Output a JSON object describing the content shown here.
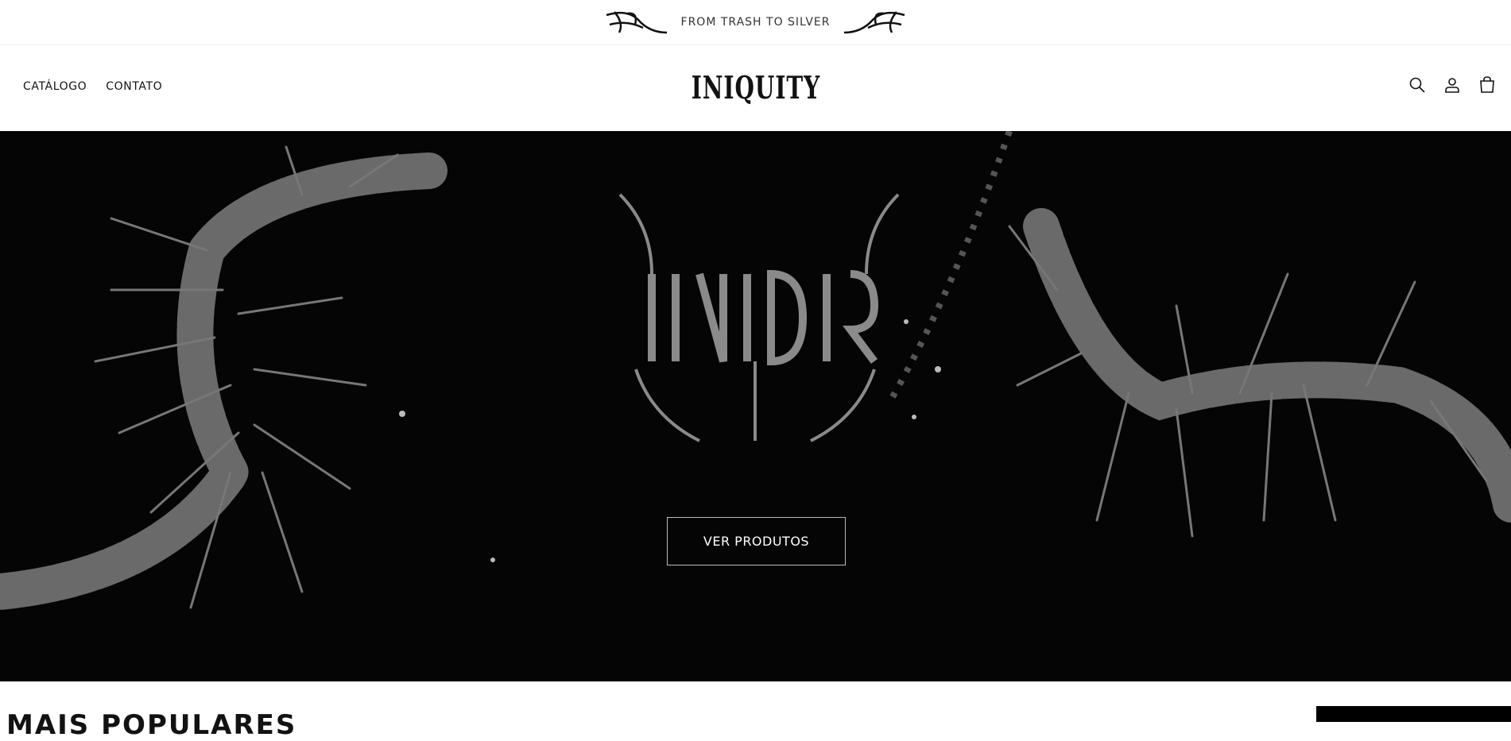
{
  "announcement": {
    "text": "FROM TRASH TO SILVER"
  },
  "header": {
    "nav": [
      {
        "label": "CATÁLOGO"
      },
      {
        "label": "CONTATO"
      }
    ],
    "logo_text": "INIQUITY",
    "icons": [
      "search-icon",
      "account-icon",
      "cart-icon"
    ]
  },
  "hero": {
    "logo_text": "INIQUITY",
    "button_label": "VER PRODUTOS"
  },
  "featured": {
    "title": "MAIS POPULARES"
  }
}
